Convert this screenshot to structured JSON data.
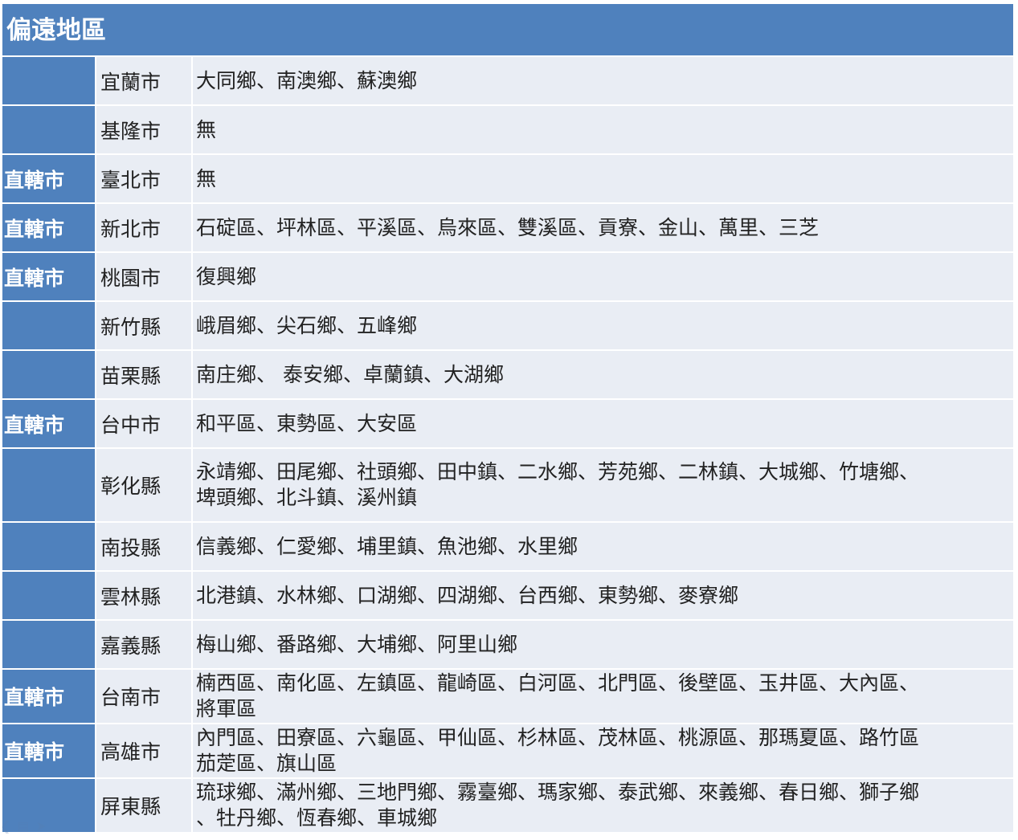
{
  "title": "偏遠地區",
  "rows": [
    {
      "tag": "",
      "city": "宜蘭市",
      "areas": "大同鄉、南澳鄉、蘇澳鄉"
    },
    {
      "tag": "",
      "city": "基隆市",
      "areas": "無"
    },
    {
      "tag": "直轄市",
      "city": "臺北市",
      "areas": "無"
    },
    {
      "tag": "直轄市",
      "city": "新北市",
      "areas": "石碇區、坪林區、平溪區、烏來區、雙溪區、貢寮、金山、萬里、三芝"
    },
    {
      "tag": "直轄市",
      "city": "桃園市",
      "areas": "復興鄉"
    },
    {
      "tag": "",
      "city": "新竹縣",
      "areas": "峨眉鄉、尖石鄉、五峰鄉"
    },
    {
      "tag": "",
      "city": "苗栗縣",
      "areas": "南庄鄉、 泰安鄉、卓蘭鎮、大湖鄉"
    },
    {
      "tag": "直轄市",
      "city": "台中市",
      "areas": "和平區、東勢區、大安區"
    },
    {
      "tag": "",
      "city": "彰化縣",
      "areas": "永靖鄉、田尾鄉、社頭鄉、田中鎮、二水鄉、芳苑鄉、二林鎮、大城鄉、竹塘鄉、",
      "areas2": "埤頭鄉、北斗鎮、溪州鎮"
    },
    {
      "tag": "",
      "city": "南投縣",
      "areas": "信義鄉、仁愛鄉、埔里鎮、魚池鄉、水里鄉"
    },
    {
      "tag": "",
      "city": "雲林縣",
      "areas": "北港鎮、水林鄉、口湖鄉、四湖鄉、台西鄉、東勢鄉、麥寮鄉"
    },
    {
      "tag": "",
      "city": "嘉義縣",
      "areas": "梅山鄉、番路鄉、大埔鄉、阿里山鄉"
    },
    {
      "tag": "直轄市",
      "city": "台南市",
      "areas": "楠西區、南化區、左鎮區、龍崎區、白河區、北門區、後壁區、玉井區、大內區、",
      "areas2": "將軍區"
    },
    {
      "tag": "直轄市",
      "city": "高雄市",
      "areas": "內門區、田寮區、六龜區、甲仙區、杉林區、茂林區、桃源區、那瑪夏區、路竹區",
      "areas2": "茄萣區、旗山區"
    },
    {
      "tag": "",
      "city": "屏東縣",
      "areas": "琉球鄉、滿州鄉、三地門鄉、霧臺鄉、瑪家鄉、泰武鄉、來義鄉、春日鄉、獅子鄉",
      "areas2": "、牡丹鄉、恆春鄉、車城鄉"
    }
  ]
}
